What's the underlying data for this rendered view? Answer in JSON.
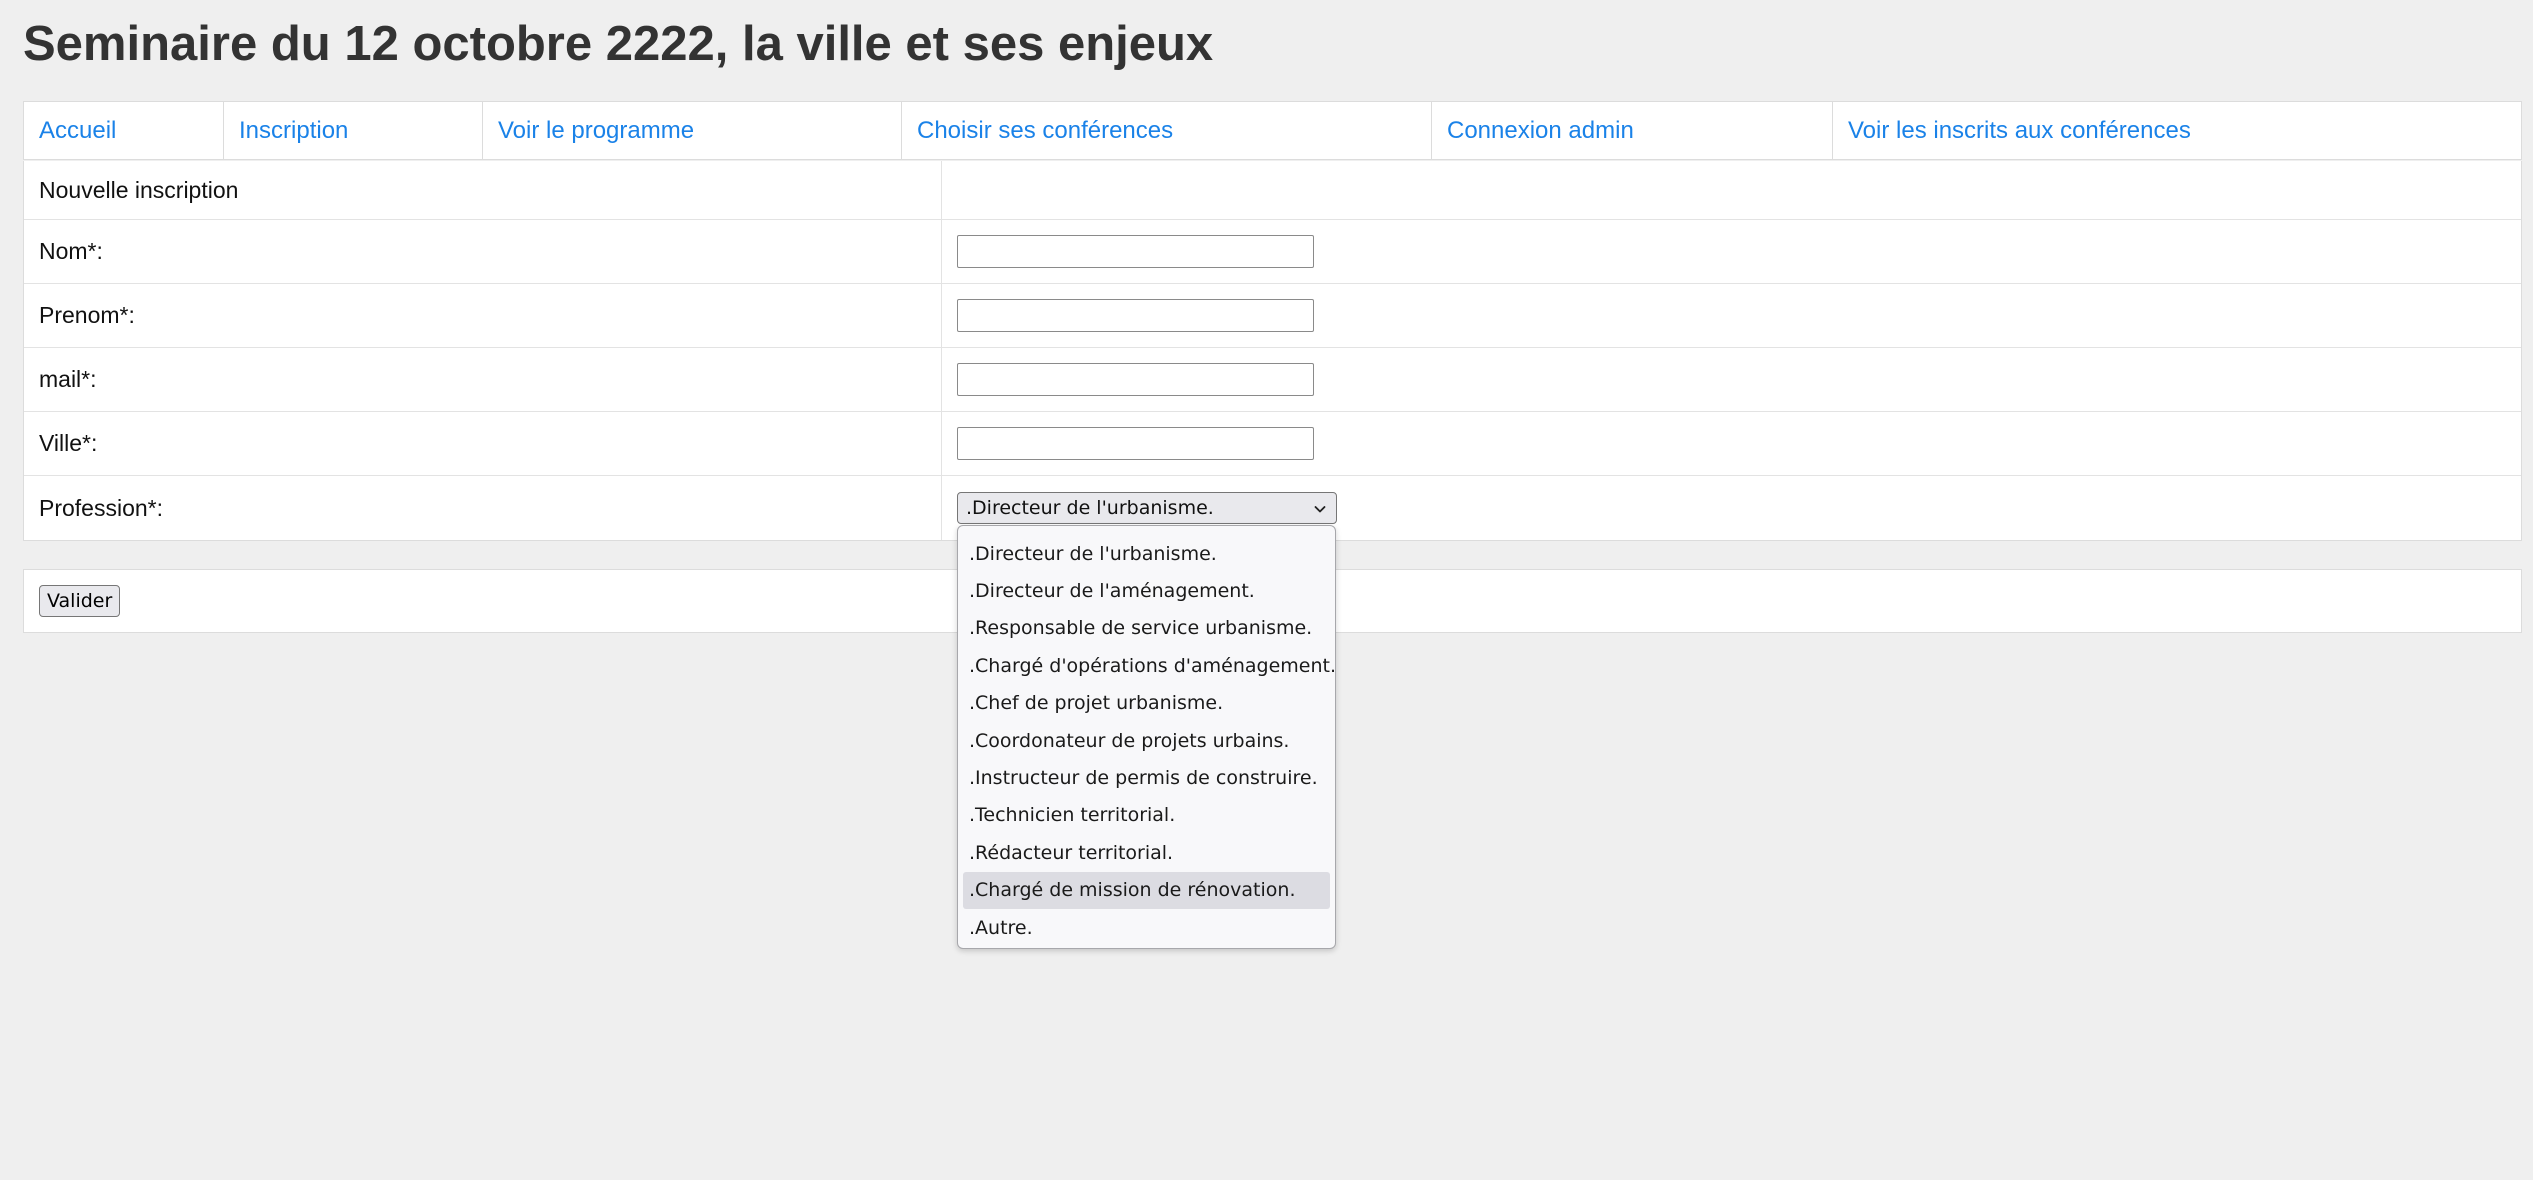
{
  "page": {
    "title": "Seminaire du 12 octobre 2222, la ville et ses enjeux"
  },
  "nav": {
    "items": [
      {
        "label": "Accueil"
      },
      {
        "label": "Inscription"
      },
      {
        "label": "Voir le programme"
      },
      {
        "label": "Choisir ses conférences"
      },
      {
        "label": "Connexion admin"
      },
      {
        "label": "Voir les inscrits aux conférences"
      }
    ]
  },
  "form": {
    "heading": "Nouvelle inscription",
    "fields": {
      "nom": {
        "label": "Nom*:",
        "value": ""
      },
      "prenom": {
        "label": "Prenom*:",
        "value": ""
      },
      "mail": {
        "label": "mail*:",
        "value": ""
      },
      "ville": {
        "label": "Ville*:",
        "value": ""
      },
      "profession": {
        "label": "Profession*:",
        "selected": ".Directeur de l'urbanisme."
      }
    },
    "submit_label": "Valider"
  },
  "dropdown": {
    "open": true,
    "highlighted_index": 9,
    "options": [
      ".Directeur de l'urbanisme.",
      ".Directeur de l'aménagement.",
      ".Responsable de service urbanisme.",
      ".Chargé d'opérations d'aménagement.",
      ".Chef de projet urbanisme.",
      ".Coordonateur de projets urbains.",
      ".Instructeur de permis de construire.",
      ".Technicien territorial.",
      ".Rédacteur territorial.",
      ".Chargé de mission de rénovation.",
      ".Autre."
    ]
  },
  "colors": {
    "link": "#1a82e8",
    "title": "#333333",
    "background": "#efefef",
    "highlight": "#dcdce2"
  },
  "icons": {
    "select_arrow": "chevron-down-icon"
  }
}
